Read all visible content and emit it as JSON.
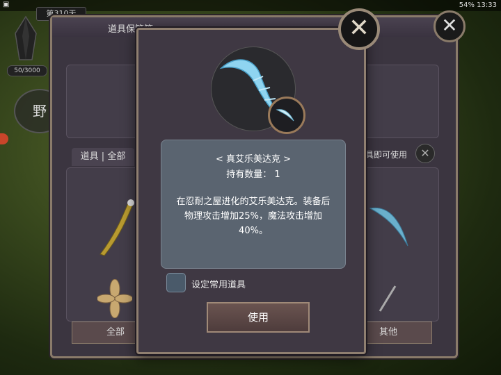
{
  "status_bar": {
    "battery": "54%",
    "time": "13:33",
    "status_text": "54% 13:33"
  },
  "hud": {
    "day": "第310天",
    "counter": "50/3000",
    "wild_label": "野"
  },
  "back_panel": {
    "title": "道具保管箱",
    "tab_label": "道具 | 全部",
    "hint": "具即可使用",
    "btn_all": "全部",
    "btn_other": "其他"
  },
  "modal": {
    "item_name": "< 真艾乐美达克 >",
    "quantity_text": "持有数量：  1",
    "description": "在忍耐之屋进化的艾乐美达克。装备后物理攻击增加25%，魔法攻击增加40%。",
    "checkbox_label": "设定常用道具",
    "use_label": "使用",
    "close_symbol": "✕"
  },
  "colors": {
    "accent": "#8f7f70",
    "panel": "#3f3843",
    "desc_bg": "#5a6470",
    "blade": "#7ec8e8"
  }
}
